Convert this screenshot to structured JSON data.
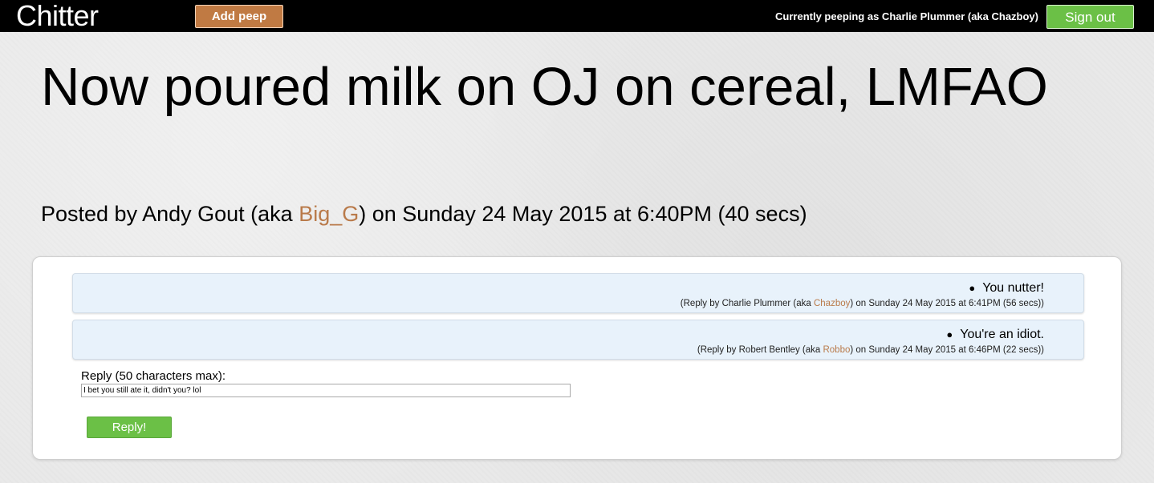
{
  "app": {
    "brand": "Chitter"
  },
  "nav": {
    "add_peep_label": "Add peep",
    "status_text": "Currently peeping as Charlie Plummer (aka Chazboy)",
    "sign_out_label": "Sign out"
  },
  "peep": {
    "text": "Now poured milk on OJ on cereal, LMFAO",
    "posted_prefix": "Posted by Andy Gout (aka ",
    "author_handle": "Big_G",
    "posted_suffix": ") on Sunday 24 May 2015 at 6:40PM (40 secs)"
  },
  "replies": [
    {
      "text": "You nutter!",
      "meta_prefix": "(Reply by Charlie Plummer (aka ",
      "handle": "Chazboy",
      "meta_suffix": ") on Sunday 24 May 2015 at 6:41PM (56 secs))"
    },
    {
      "text": "You're an idiot.",
      "meta_prefix": "(Reply by Robert Bentley (aka ",
      "handle": "Robbo",
      "meta_suffix": ") on Sunday 24 May 2015 at 6:46PM (22 secs))"
    }
  ],
  "reply_form": {
    "label": "Reply (50 characters max):",
    "value": "I bet you still ate it, didn't you? lol",
    "submit_label": "Reply!"
  },
  "colors": {
    "navbar": "#000000",
    "add_peep_button": "#c07a43",
    "sign_out_button": "#6bc046",
    "reply_button": "#6bc046",
    "handle_link": "#b97a4a",
    "reply_background": "#e8f2fb"
  }
}
